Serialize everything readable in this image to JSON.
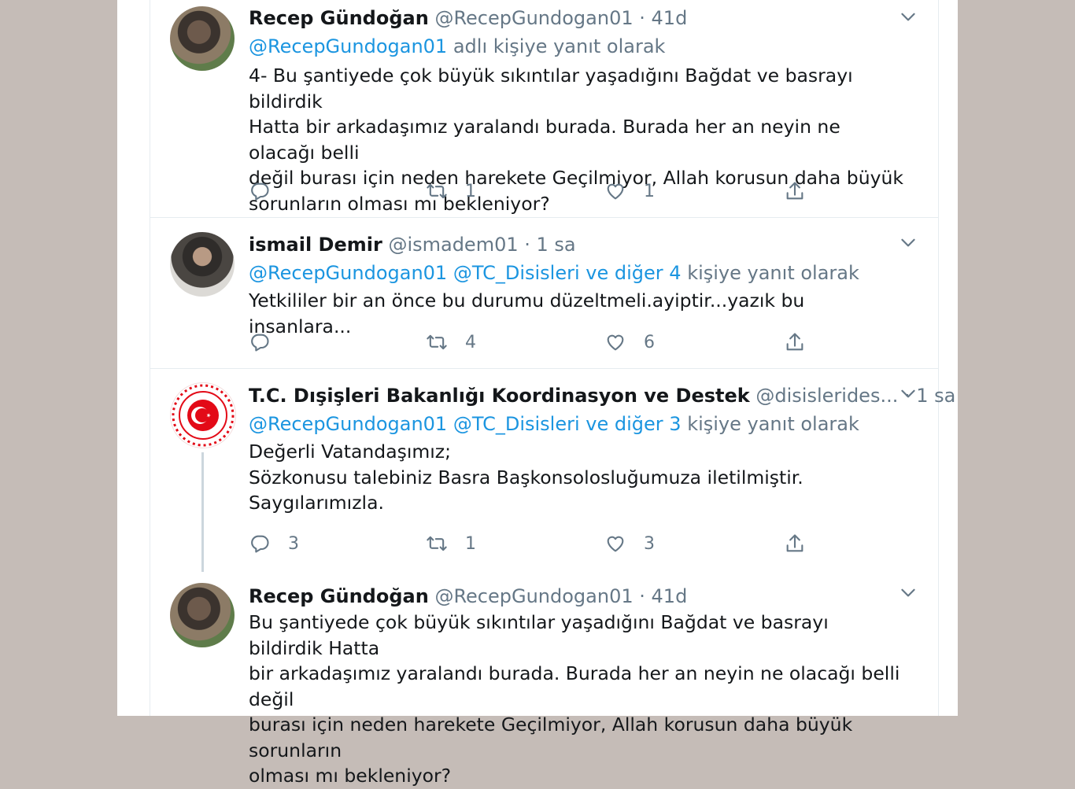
{
  "tweets": [
    {
      "name": "Recep Gündoğan",
      "handle": "@RecepGundogan01",
      "time": "· 41d",
      "reply_to": [
        "@RecepGundogan01"
      ],
      "reply_suffix": "adlı kişiye yanıt olarak",
      "text_lines": [
        "4- Bu şantiyede çok büyük sıkıntılar yaşadığını Bağdat ve basrayı bildirdik",
        "Hatta bir arkadaşımız yaralandı burada. Burada her an neyin ne olacağı belli",
        "değil burası için neden harekete Geçilmiyor, Allah korusun daha büyük",
        "sorunların olması mı bekleniyor?"
      ],
      "replies": "",
      "retweets": "1",
      "likes": "1"
    },
    {
      "name": "ismail Demir",
      "handle": "@ismadem01",
      "time": "· 1 sa",
      "reply_to": [
        "@RecepGundogan01",
        "@TC_Disisleri",
        "ve diğer 4"
      ],
      "reply_suffix": "kişiye yanıt olarak",
      "text_lines": [
        "Yetkililer bir an önce bu durumu düzeltmeli.ayiptir...yazık bu insanlara..."
      ],
      "replies": "",
      "retweets": "4",
      "likes": "6"
    },
    {
      "name": "T.C. Dışişleri Bakanlığı Koordinasyon ve Destek",
      "handle": "@disislerides...",
      "time": "· 1 sa",
      "reply_to": [
        "@RecepGundogan01",
        "@TC_Disisleri",
        "ve diğer 3"
      ],
      "reply_suffix": "kişiye yanıt olarak",
      "text_lines": [
        "Değerli Vatandaşımız;",
        "Sözkonusu talebiniz Basra Başkonsolosluğumuza iletilmiştir.",
        "Saygılarımızla."
      ],
      "replies": "3",
      "retweets": "1",
      "likes": "3"
    },
    {
      "name": "Recep Gündoğan",
      "handle": "@RecepGundogan01",
      "time": "· 41d",
      "text_lines": [
        "Bu şantiyede çok büyük sıkıntılar yaşadığını Bağdat ve basrayı bildirdik Hatta",
        "bir arkadaşımız yaralandı burada. Burada her an neyin ne olacağı belli değil",
        "burası için neden harekete Geçilmiyor, Allah korusun daha büyük sorunların",
        "olması mı bekleniyor?"
      ]
    }
  ],
  "colors": {
    "link": "#1b95e0",
    "meta": "#657786",
    "text": "#14171a",
    "backdrop": "#c5bcb7"
  },
  "icons": [
    "reply-icon",
    "retweet-icon",
    "like-icon",
    "share-icon",
    "chevron-down-icon",
    "turkish-flag-logo"
  ]
}
